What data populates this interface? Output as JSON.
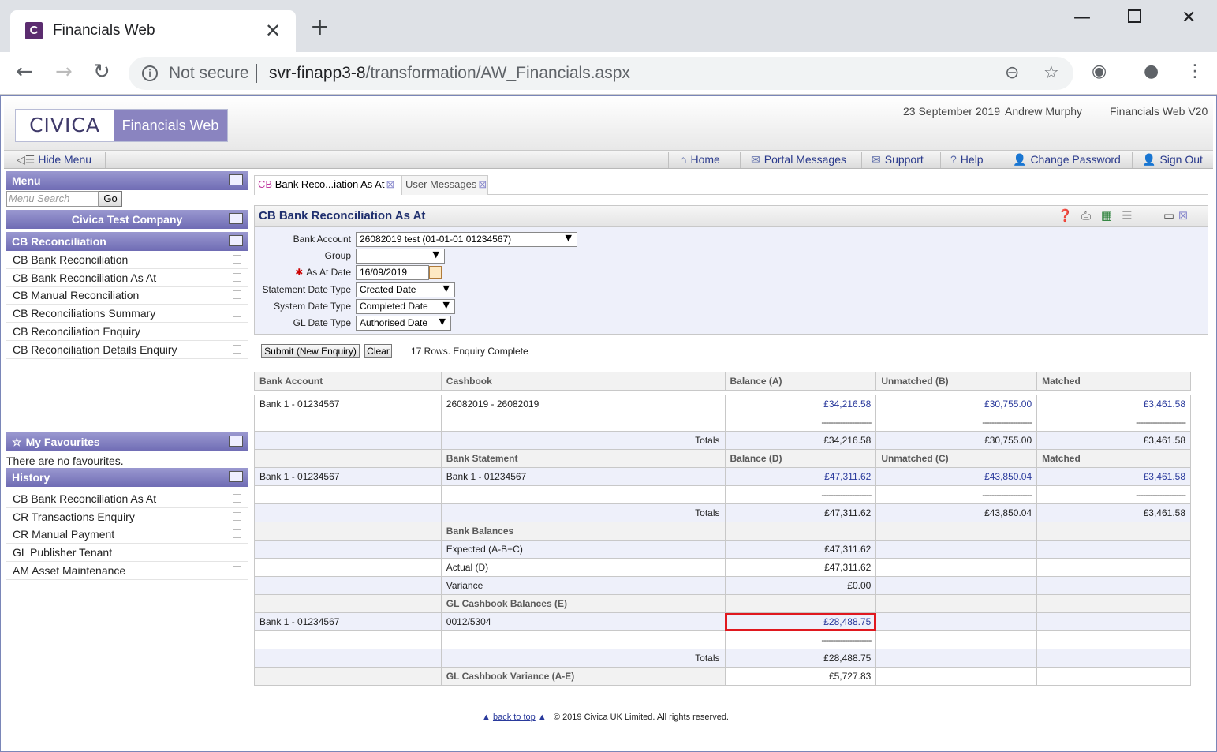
{
  "browser": {
    "tab_title": "Financials Web",
    "tab_favicon": "C",
    "security": "Not secure",
    "url_host": "svr-finapp3-8",
    "url_path": "/transformation/AW_Financials.aspx"
  },
  "header": {
    "logo_brand": "CIVICA",
    "logo_product": "Financials Web",
    "date": "23 September 2019",
    "user": "Andrew Murphy",
    "version": "Financials Web V20"
  },
  "navbar": {
    "hide_menu": "Hide Menu",
    "items": [
      "Home",
      "Portal Messages",
      "Support",
      "Help",
      "Change Password",
      "Sign Out"
    ]
  },
  "sidebar": {
    "menu_title": "Menu",
    "search_placeholder": "Menu Search",
    "go": "Go",
    "company": "Civica Test Company",
    "section": "CB Reconciliation",
    "items": [
      "CB Bank Reconciliation",
      "CB Bank Reconciliation As At",
      "CB Manual Reconciliation",
      "CB Reconciliations Summary",
      "CB Reconciliation Enquiry",
      "CB Reconciliation Details Enquiry"
    ],
    "favourites_title": "My Favourites",
    "favourites_empty": "There are no favourites.",
    "history_title": "History",
    "history": [
      "CB Bank Reconciliation As At",
      "CR Transactions Enquiry",
      "CR Manual Payment",
      "GL Publisher Tenant",
      "AM Asset Maintenance"
    ]
  },
  "content_tabs": [
    {
      "prefix": "CB",
      "label": "Bank Reco...iation As At"
    },
    {
      "prefix": "",
      "label": "User Messages"
    }
  ],
  "page": {
    "title": "CB Bank Reconciliation As At"
  },
  "filters": {
    "bank_account_label": "Bank Account",
    "bank_account_value": "26082019 test (01-01-01 01234567)",
    "group_label": "Group",
    "group_value": "",
    "as_at_label": "As At Date",
    "as_at_value": "16/09/2019",
    "stmt_type_label": "Statement Date Type",
    "stmt_type_value": "Created Date",
    "sys_type_label": "System Date Type",
    "sys_type_value": "Completed Date",
    "gl_type_label": "GL Date Type",
    "gl_type_value": "Authorised Date"
  },
  "actions": {
    "submit": "Submit (New Enquiry)",
    "clear": "Clear",
    "status": "17 Rows. Enquiry Complete"
  },
  "grid": {
    "headers": [
      "Bank Account",
      "Cashbook",
      "Balance (A)",
      "Unmatched (B)",
      "Matched"
    ],
    "dashes": "---------------------",
    "totals_label": "Totals",
    "row1": [
      "Bank 1 - 01234567",
      "26082019 - 26082019",
      "£34,216.58",
      "£30,755.00",
      "£3,461.58"
    ],
    "totals1": [
      "£34,216.58",
      "£30,755.00",
      "£3,461.58"
    ],
    "sub_headers": [
      "Bank Statement",
      "Balance (D)",
      "Unmatched (C)",
      "Matched"
    ],
    "row2": [
      "Bank 1 - 01234567",
      "Bank 1 - 01234567",
      "£47,311.62",
      "£43,850.04",
      "£3,461.58"
    ],
    "totals2": [
      "£47,311.62",
      "£43,850.04",
      "£3,461.58"
    ],
    "bank_balances": "Bank Balances",
    "expected_label": "Expected (A-B+C)",
    "expected_value": "£47,311.62",
    "actual_label": "Actual (D)",
    "actual_value": "£47,311.62",
    "variance_label": "Variance",
    "variance_value": "£0.00",
    "gl_balances": "GL Cashbook Balances (E)",
    "row3": [
      "Bank 1 - 01234567",
      "0012/5304",
      "£28,488.75"
    ],
    "totals3": "£28,488.75",
    "gl_variance_label": "GL Cashbook Variance (A-E)",
    "gl_variance_value": "£5,727.83"
  },
  "footer": {
    "back_to_top": "back to top",
    "copyright": "© 2019 Civica UK Limited. All rights reserved."
  }
}
